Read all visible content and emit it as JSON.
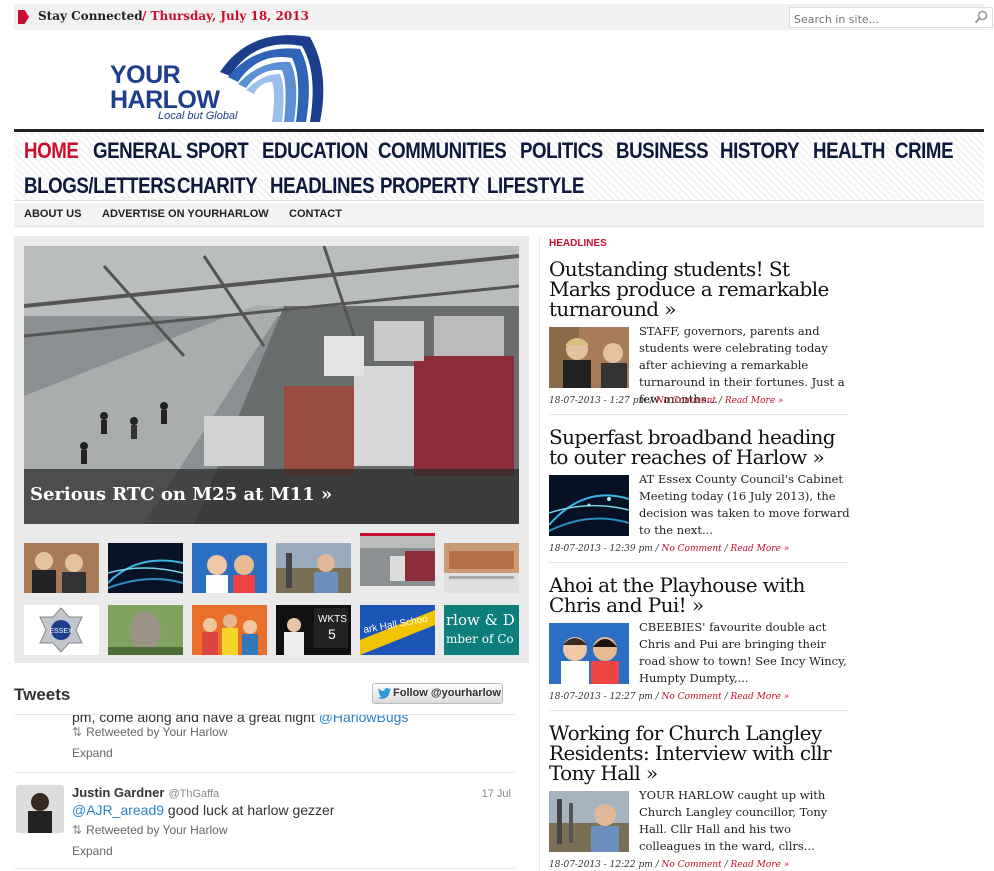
{
  "topbar": {
    "stay_connected": "Stay Connected",
    "date": "/ Thursday, July 18, 2013",
    "search_placeholder": "Search in site..."
  },
  "logo": {
    "line1": "YOUR",
    "line2": "HARLOW",
    "tagline": "Local but Global"
  },
  "nav": {
    "items": [
      "HOME",
      "GENERAL",
      "SPORT",
      "EDUCATION",
      "COMMUNITIES",
      "POLITICS",
      "BUSINESS",
      "HISTORY",
      "HEALTH",
      "CRIME",
      "BLOGS/LETTERS",
      "CHARITY",
      "HEADLINES",
      "PROPERTY",
      "LIFESTYLE"
    ],
    "active": "HOME"
  },
  "subnav": {
    "items": [
      "ABOUT US",
      "ADVERTISE ON YOURHARLOW",
      "CONTACT"
    ]
  },
  "slider": {
    "caption": "Serious RTC on M25 at M11 »"
  },
  "tweets": {
    "title": "Tweets",
    "follow_label": "Follow @yourharlow",
    "first_cut_text": "pm, come along and have a great night ",
    "first_cut_link": "@HarlowBugs",
    "retweeted_by": "Retweeted by Your Harlow",
    "expand": "Expand",
    "second": {
      "name": "Justin Gardner",
      "handle": "@ThGaffa",
      "date": "17 Jul",
      "mention": "@AJR_aread9",
      "text": " good luck at harlow gezzer"
    }
  },
  "headlines": {
    "label": "HEADLINES",
    "posts": [
      {
        "title": "Outstanding students! St Marks produce a remarkable turnaround »",
        "excerpt": "STAFF, governors, parents and students were celebrating today after achieving a remarkable turnaround in their fortunes. Just a few months...",
        "date": "18-07-2013 - 1:27 pm / ",
        "comment": "No Comment",
        "more": "Read More »"
      },
      {
        "title": "Superfast broadband heading to outer reaches of Harlow »",
        "excerpt": "AT Essex County Council's Cabinet Meeting today (16 July 2013), the decision was taken to move forward to the next...",
        "date": "18-07-2013 - 12:39 pm / ",
        "comment": "No Comment",
        "more": "Read More »"
      },
      {
        "title": "Ahoi at the Playhouse with Chris and Pui! »",
        "excerpt": "CBEEBIES' favourite double act Chris and Pui are bringing their road show to town! See Incy Wincy, Humpty Dumpty,...",
        "date": "18-07-2013 - 12:27 pm / ",
        "comment": "No Comment",
        "more": "Read More »"
      },
      {
        "title": "Working for Church Langley Residents: Interview with cllr Tony Hall »",
        "excerpt": "YOUR HARLOW caught up with Church Langley councillor, Tony Hall. Cllr Hall and his two colleagues in the ward, cllrs...",
        "date": "18-07-2013 - 12:22 pm / ",
        "comment": "No Comment",
        "more": "Read More »"
      }
    ]
  },
  "thumbs": {
    "wkts_label": "WKTS",
    "wkts_number": "5",
    "school_text": "ark Hall Schoo",
    "chamber_line1": "rlow & D",
    "chamber_line2": "mber of Co",
    "essex_text": "ESSEX"
  }
}
